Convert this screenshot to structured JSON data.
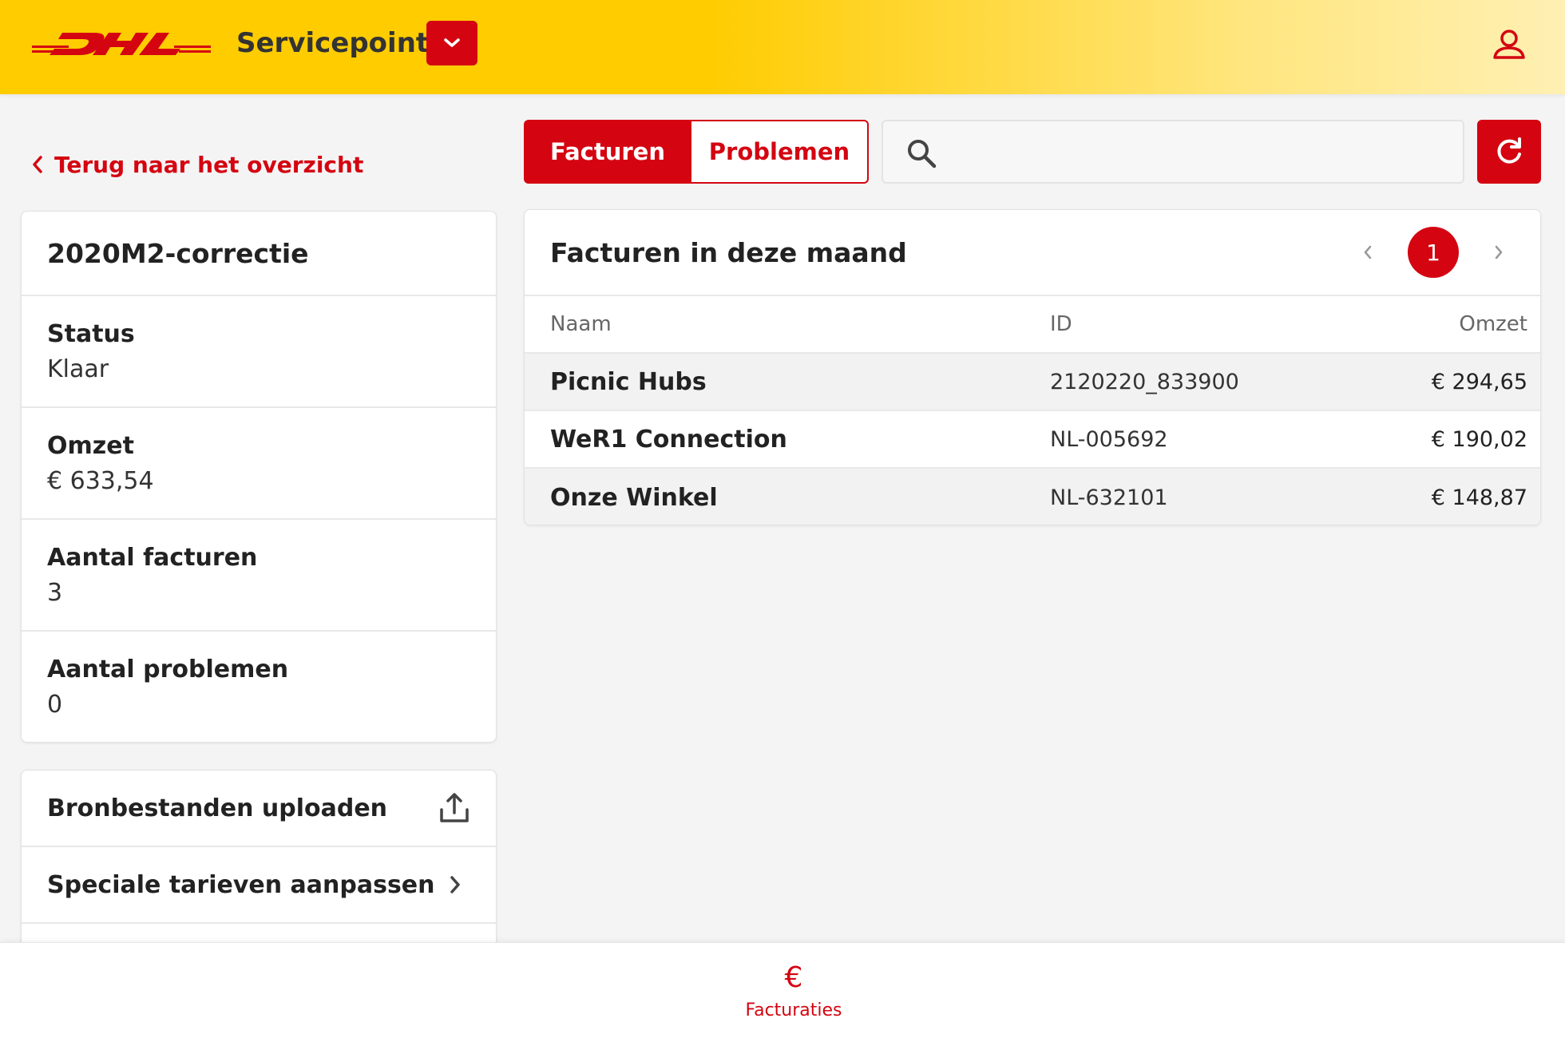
{
  "header": {
    "logo_text": "DHL",
    "app_title": "Servicepoints",
    "brand_red": "#d40511",
    "brand_yellow": "#ffcc00"
  },
  "back_link": {
    "label": "Terug naar het overzicht",
    "icon": "chevron-left-icon"
  },
  "tabs": [
    {
      "label": "Facturen",
      "active": true
    },
    {
      "label": "Problemen",
      "active": false
    }
  ],
  "search": {
    "placeholder": "",
    "value": "",
    "icon": "search-icon"
  },
  "refresh": {
    "icon": "refresh-icon"
  },
  "info_card": {
    "title": "2020M2-correctie",
    "rows": [
      {
        "label": "Status",
        "value": "Klaar"
      },
      {
        "label": "Omzet",
        "value": "€ 633,54"
      },
      {
        "label": "Aantal facturen",
        "value": "3"
      },
      {
        "label": "Aantal problemen",
        "value": "0"
      }
    ]
  },
  "actions": [
    {
      "label": "Bronbestanden uploaden",
      "icon": "upload-icon"
    },
    {
      "label": "Speciale tarieven aanpassen",
      "icon": "chevron-right-icon"
    }
  ],
  "invoices": {
    "title": "Facturen in deze maand",
    "current_page": "1",
    "columns": {
      "name": "Naam",
      "id": "ID",
      "amount": "Omzet"
    },
    "rows": [
      {
        "name": "Picnic Hubs",
        "id": "2120220_833900",
        "amount": "€ 294,65"
      },
      {
        "name": "WeR1 Connection",
        "id": "NL-005692",
        "amount": "€ 190,02"
      },
      {
        "name": "Onze Winkel",
        "id": "NL-632101",
        "amount": "€ 148,87"
      }
    ]
  },
  "bottom_nav": {
    "icon": "€",
    "label": "Facturaties"
  }
}
